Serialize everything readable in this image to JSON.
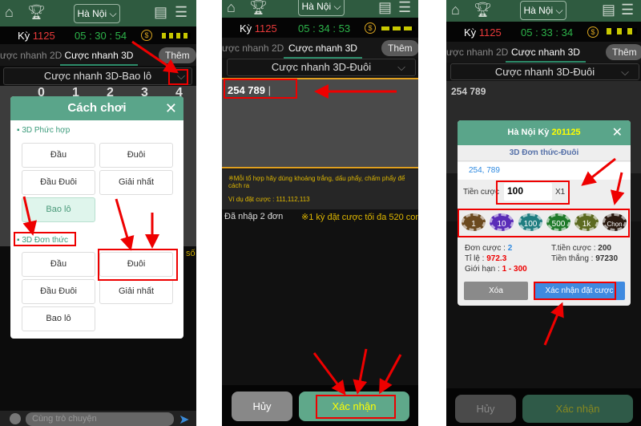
{
  "common": {
    "city": "Hà Nội",
    "ky_label": "Kỳ",
    "ky_number": "1125",
    "tab_2d": "ược nhanh 2D",
    "tab_3d": "Cược nhanh 3D",
    "more": "Thêm"
  },
  "panel1": {
    "timer": "05 : 30 : 54",
    "dropdown": "Cược nhanh 3D-Bao lô",
    "grid_headers": [
      "0",
      "1",
      "2",
      "3",
      "4"
    ],
    "modal": {
      "title": "Cách chơi",
      "section1": "3D Phức hợp",
      "section1_options": [
        "Đầu",
        "Đuôi",
        "Đầu Đuôi",
        "Giải nhất",
        "Bao lô"
      ],
      "section2": "3D Đơn thức",
      "section2_options": [
        "Đầu",
        "Đuôi",
        "Đầu Đuôi",
        "Giải nhất",
        "Bao lô"
      ]
    },
    "chat_placeholder": "Cùng trò chuyện",
    "side_text": "số"
  },
  "panel2": {
    "timer": "05 : 34 : 53",
    "dropdown": "Cược nhanh 3D-Đuôi",
    "input_value": "254  789",
    "hint": "※Mỗi tổ hợp hãy dùng khoảng trắng, dấu phẩy, chấm phẩy để cách ra",
    "example": "Ví dụ đặt cược : 111,112,113",
    "entered": "Đã nhập 2 đơn",
    "limit": "※1 kỳ đặt cược tối đa 520 con số",
    "cancel": "Hủy",
    "confirm": "Xác nhận"
  },
  "panel3": {
    "timer": "05 : 33 : 34",
    "dropdown": "Cược nhanh 3D-Đuôi",
    "input_value": "254  789",
    "modal": {
      "title_prefix": "Hà Nội Kỳ",
      "title_number": "201125",
      "bet_type": "3D Đơn thức-Đuôi",
      "numbers": "254, 789",
      "stake_label": "Tiền cược",
      "stake_value": "100",
      "multiplier": "X1",
      "chips": [
        {
          "label": "1",
          "color": "#6b4a1f"
        },
        {
          "label": "10",
          "color": "#5a2cb8"
        },
        {
          "label": "100",
          "color": "#1f7d80"
        },
        {
          "label": "500",
          "color": "#1f7a2a"
        },
        {
          "label": "1k",
          "color": "#5c6a20"
        },
        {
          "label": "Chọn",
          "color": "#2a1a10"
        }
      ],
      "orders_label": "Đơn cược :",
      "orders_value": "2",
      "rate_label": "Tỉ lệ :",
      "rate_value": "972.3",
      "limit_label": "Giới hạn :",
      "limit_value": "1 - 300",
      "total_label": "T.tiền cược :",
      "total_value": "200",
      "win_label": "Tiền thắng :",
      "win_value": "97230",
      "clear": "Xóa",
      "confirm": "Xác nhận đặt cược"
    },
    "cancel": "Hủy",
    "confirm": "Xác nhận"
  },
  "colors": {
    "header": "#2f5b40",
    "accent": "#5aa58a",
    "annotation": "#e00000"
  }
}
